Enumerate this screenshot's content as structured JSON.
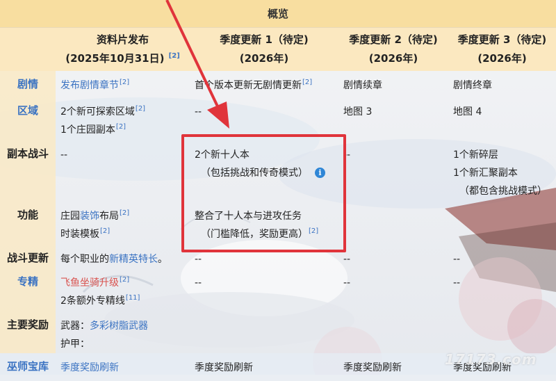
{
  "table": {
    "title": "概览",
    "headers": [
      {
        "line1": "资料片发布",
        "line2": "(2025年10月31日)",
        "ref": "[2]"
      },
      {
        "line1": "季度更新 1（待定)",
        "line2": "(2026年)"
      },
      {
        "line1": "季度更新 2（待定)",
        "line2": "(2026年)"
      },
      {
        "line1": "季度更新 3（待定)",
        "line2": "(2026年)"
      }
    ],
    "rows": {
      "plot": {
        "label": "剧情",
        "c1": "发布剧情章节",
        "c1_ref": "[2]",
        "c2": "首个版本更新无剧情更新",
        "c2_ref": "[2]",
        "c3": "剧情续章",
        "c4": "剧情终章"
      },
      "region": {
        "label": "区域",
        "c1_a": "2个新可探索区域",
        "c1_a_ref": "[2]",
        "c1_b": "1个庄园副本",
        "c1_b_ref": "[2]",
        "c2": "--",
        "c3": "地图 3",
        "c4": "地图 4"
      },
      "dungeon": {
        "label": "副本战斗",
        "c1": "--",
        "c2_a": "2个新十人本",
        "c2_b": "（包括挑战和传奇模式）",
        "c3": "--",
        "c4_a": "1个新碎层",
        "c4_b": "1个新汇聚副本",
        "c4_c": "（都包含挑战模式）"
      },
      "feature": {
        "label": "功能",
        "c1_a_pre": "庄园",
        "c1_a_link": "装饰",
        "c1_a_post": "布局",
        "c1_a_ref": "[2]",
        "c1_b": "时装模板",
        "c1_b_ref": "[2]",
        "c2_a": "整合了十人本与进攻任务",
        "c2_b": "（门槛降低，奖励更高）",
        "c2_ref": "[2]"
      },
      "combat": {
        "label": "战斗更新",
        "c1_pre": "每个职业的",
        "c1_link": "新精英特长",
        "c1_post": "。",
        "c2": "--",
        "c3": "--",
        "c4": "--"
      },
      "mastery": {
        "label": "专精",
        "c1_a": "飞鱼坐骑升级",
        "c1_a_ref": "[2]",
        "c1_b": "2条额外专精线",
        "c1_b_ref": "[11]",
        "c2": "--",
        "c3": "--",
        "c4": "--"
      },
      "rewards": {
        "label": "主要奖励",
        "weapon_label": "武器：",
        "weapon_link": "多彩树脂武器",
        "armor_label": "护甲："
      },
      "vault": {
        "label": "巫师宝库",
        "c1": "季度奖励刷新",
        "c2": "季度奖励刷新",
        "c3": "季度奖励刷新",
        "c4": "季度奖励刷新"
      }
    },
    "info_icon": "info-icon"
  },
  "watermark": "17173.com",
  "colors": {
    "highlight": "#e0343b",
    "link": "#3b73c2",
    "header_bg": "#f8dea0"
  }
}
